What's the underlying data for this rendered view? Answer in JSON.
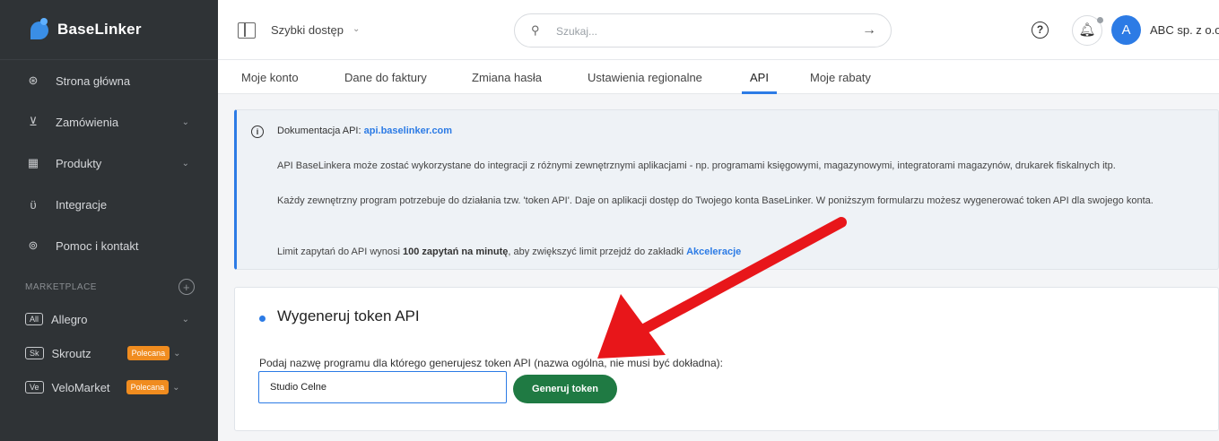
{
  "app": {
    "logo_text": "BaseLinker"
  },
  "sidebar": {
    "items": [
      {
        "label": "Strona główna",
        "icon": "dashboard-icon",
        "glyph": "⊛",
        "chevron": false
      },
      {
        "label": "Zamówienia",
        "icon": "cart-icon",
        "glyph": "🛒",
        "chevron": true
      },
      {
        "label": "Produkty",
        "icon": "boxes-icon",
        "glyph": "▦",
        "chevron": true
      },
      {
        "label": "Integracje",
        "icon": "plug-icon",
        "glyph": "⏚",
        "chevron": false
      },
      {
        "label": "Pomoc i kontakt",
        "icon": "help-circle-icon",
        "glyph": "?",
        "chevron": false
      }
    ],
    "marketplace_heading": "MARKETPLACE",
    "marketplaces": [
      {
        "code": "All",
        "label": "Allegro",
        "badge": ""
      },
      {
        "code": "Sk",
        "label": "Skroutz",
        "badge": "Polecana"
      },
      {
        "code": "Ve",
        "label": "VeloMarket",
        "badge": "Polecana"
      }
    ]
  },
  "topbar": {
    "quick_access_label": "Szybki dostęp",
    "search_placeholder": "Szukaj...",
    "avatar_letter": "A",
    "company_name": "ABC sp. z o.o"
  },
  "tabs": [
    "Moje konto",
    "Dane do faktury",
    "Zmiana hasła",
    "Ustawienia regionalne",
    "API",
    "Moje rabaty"
  ],
  "active_tab": "API",
  "info": {
    "doc_label": "Dokumentacja API:",
    "doc_link": "api.baselinker.com",
    "p1": "API BaseLinkera może zostać wykorzystane do integracji z różnymi zewnętrznymi aplikacjami - np. programami księgowymi, magazynowymi, integratorami magazynów, drukarek fiskalnych itp.",
    "p2": "Każdy zewnętrzny program potrzebuje do działania tzw. 'token API'. Daje on aplikacji dostęp do Twojego konta BaseLinker. W poniższym formularzu możesz wygenerować token API dla swojego konta.",
    "p3_prefix": "Limit zapytań do API wynosi ",
    "p3_bold": "100 zapytań na minutę",
    "p3_middle": ", aby zwiększyć limit przejdź do zakładki ",
    "p3_link": "Akceleracje"
  },
  "token_form": {
    "title": "Wygeneruj token API",
    "label": "Podaj nazwę programu dla którego generujesz token API (nazwa ogólna, nie musi być dokładna):",
    "input_value": "Studio Celne",
    "button_label": "Generuj token"
  },
  "colors": {
    "accent": "#2c7be5",
    "button": "#1f7a43",
    "badge": "#f08c1f",
    "sidebar": "#2f3336",
    "arrow": "#e8161a"
  }
}
